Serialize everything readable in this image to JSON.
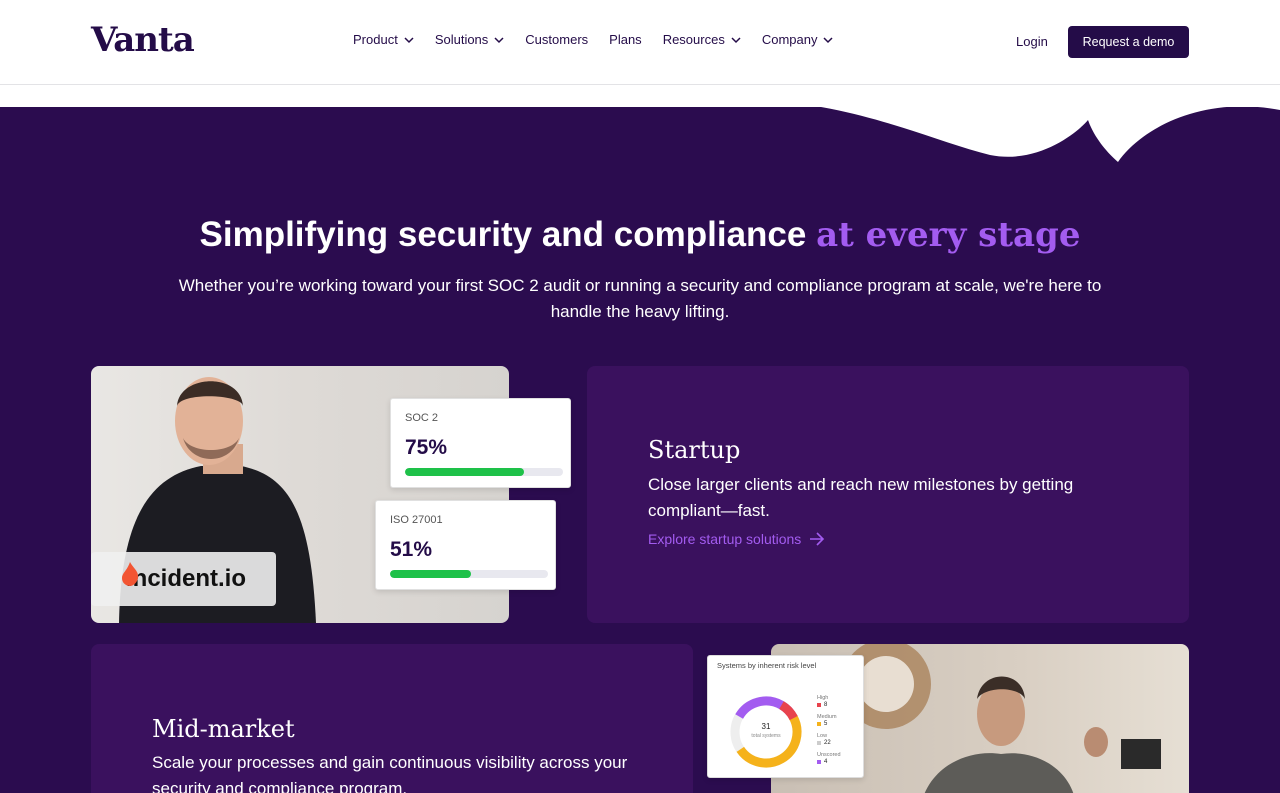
{
  "header": {
    "logo": "Vanta",
    "nav": [
      {
        "label": "Product",
        "dropdown": true
      },
      {
        "label": "Solutions",
        "dropdown": true
      },
      {
        "label": "Customers",
        "dropdown": false
      },
      {
        "label": "Plans",
        "dropdown": false
      },
      {
        "label": "Resources",
        "dropdown": true
      },
      {
        "label": "Company",
        "dropdown": true
      }
    ],
    "login": "Login",
    "demo": "Request a demo"
  },
  "hero": {
    "title": "Simplifying security and compliance",
    "title_accent": "at every stage",
    "subtitle": "Whether you’re working toward your first SOC 2 audit or running a security and compliance program at scale, we're here to handle the heavy lifting."
  },
  "startup": {
    "title": "Startup",
    "desc": "Close larger clients and reach new milestones by getting compliant—fast.",
    "link": "Explore startup solutions",
    "brand": "incident.io",
    "stats": [
      {
        "label": "SOC 2",
        "value": "75%",
        "progress": 0.75
      },
      {
        "label": "ISO 27001",
        "value": "51%",
        "progress": 0.51
      }
    ]
  },
  "midmarket": {
    "title": "Mid-market",
    "desc": "Scale your processes and gain continuous visibility across your security and compliance program.",
    "risk_card": {
      "title": "Systems by inherent risk level",
      "total": "31",
      "total_label": "total systems",
      "levels": [
        {
          "label": "High",
          "value": "8",
          "color": "#e8434d"
        },
        {
          "label": "Medium",
          "value": "5",
          "color": "#f5b21b"
        },
        {
          "label": "Low",
          "value": "22",
          "color": "#cccccc"
        },
        {
          "label": "Unscored",
          "value": "4",
          "color": "#a35cf0"
        }
      ]
    }
  },
  "colors": {
    "brand_dark": "#240c48",
    "hero_bg": "#2b0c4f",
    "card_bg": "#3a115e",
    "accent_purple": "#a35cf0",
    "progress_green": "#1ec149"
  }
}
